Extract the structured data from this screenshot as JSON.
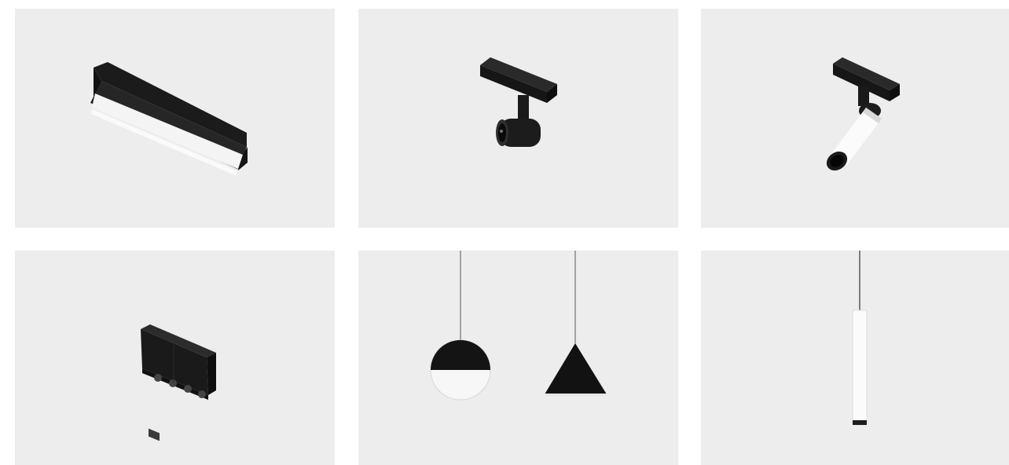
{
  "products": [
    {
      "icon": "linear-track-light-icon"
    },
    {
      "icon": "track-spotlight-icon"
    },
    {
      "icon": "track-cylinder-spot-icon"
    },
    {
      "icon": "grille-track-light-icon"
    },
    {
      "icon": "pendant-sphere-cone-icon"
    },
    {
      "icon": "pendant-tube-icon"
    }
  ],
  "colors": {
    "tile_background": "#ededed",
    "fixture_black": "#1e1e1e",
    "fixture_white": "#ffffff"
  }
}
